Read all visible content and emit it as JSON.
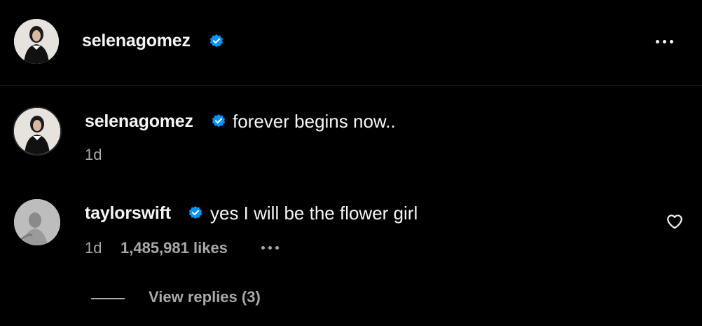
{
  "post": {
    "author": "selenagomez",
    "verified": true,
    "more_icon": "more-horizontal-icon"
  },
  "caption": {
    "username": "selenagomez",
    "text": "forever begins now..",
    "time": "1d"
  },
  "comment": {
    "username": "taylorswift",
    "text": "yes I will be the flower girl",
    "time": "1d",
    "likes": "1,485,981 likes",
    "like_icon": "heart-icon",
    "replies_label": "View replies (3)"
  },
  "colors": {
    "background": "#000000",
    "primary_text": "#f5f5f5",
    "secondary_text": "#a8a8a8",
    "verified_badge": "#0095f6",
    "divider": "#262626"
  }
}
